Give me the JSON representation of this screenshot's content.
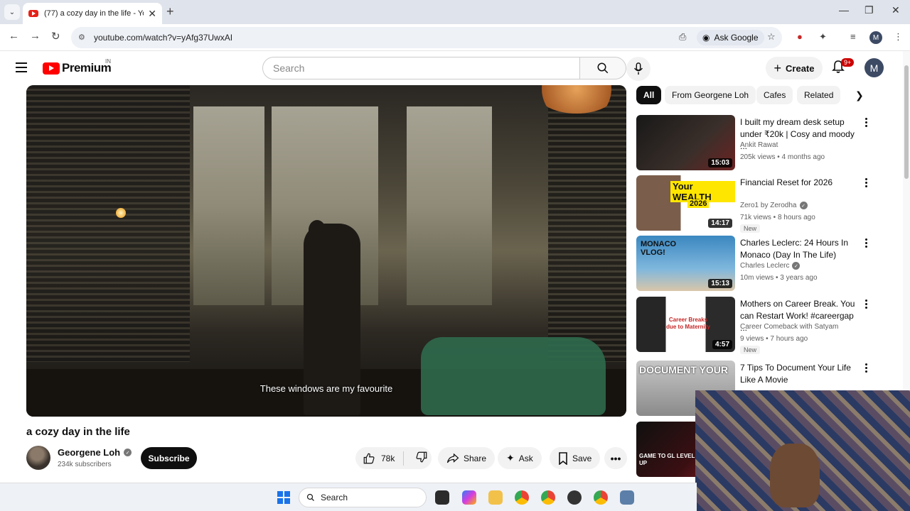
{
  "browser": {
    "tab_title": "(77) a cozy day in the life - YouT",
    "url": "youtube.com/watch?v=yAfg37UwxAI",
    "ask_google": "Ask Google",
    "profile_initial": "M"
  },
  "header": {
    "logo_text": "Premium",
    "country_code": "IN",
    "search_placeholder": "Search",
    "create_label": "Create",
    "notif_count": "9+",
    "avatar_initial": "M"
  },
  "video": {
    "subtitle": "These windows are my favourite",
    "title": "a cozy day in the life",
    "channel": "Georgene Loh",
    "subscribers": "234k subscribers",
    "subscribe_label": "Subscribe",
    "likes": "78k",
    "share_label": "Share",
    "ask_label": "Ask",
    "save_label": "Save"
  },
  "chips": [
    "All",
    "From Georgene Loh",
    "Cafes",
    "Related"
  ],
  "recommendations": [
    {
      "title": "I built my dream desk setup under ₹20k | Cosy and moody ...",
      "channel": "Ankit Rawat",
      "verified": false,
      "meta": "205k views • 4 months ago",
      "duration": "15:03",
      "badge": ""
    },
    {
      "title": "Financial Reset for 2026",
      "channel": "Zero1 by Zerodha",
      "verified": true,
      "meta": "71k views • 8 hours ago",
      "duration": "14:17",
      "badge": "New",
      "thumb_text_1": "Your WEALTH",
      "thumb_text_2": "2026"
    },
    {
      "title": "Charles Leclerc: 24 Hours In Monaco (Day In The Life)",
      "channel": "Charles Leclerc",
      "verified": true,
      "meta": "10m views • 3 years ago",
      "duration": "15:13",
      "badge": "",
      "thumb_text_1": "MONACO VLOG!"
    },
    {
      "title": "Mothers on Career Break. You can Restart Work! #careergap ...",
      "channel": "Career Comeback with Satyam",
      "verified": false,
      "meta": "9 views • 7 hours ago",
      "duration": "4:57",
      "badge": "New",
      "thumb_text_1": "Career Breaks due to Maternity"
    },
    {
      "title": "7 Tips To Document Your Life Like A Movie",
      "channel": "",
      "verified": false,
      "meta": "",
      "duration": "",
      "badge": "",
      "thumb_text_1": "DOCUMENT YOUR"
    },
    {
      "title": "",
      "channel": "",
      "verified": false,
      "meta": "",
      "duration": "",
      "badge": "",
      "thumb_text_1": "GAME TO GL LEVEL UP"
    }
  ],
  "taskbar": {
    "search_label": "Search"
  }
}
